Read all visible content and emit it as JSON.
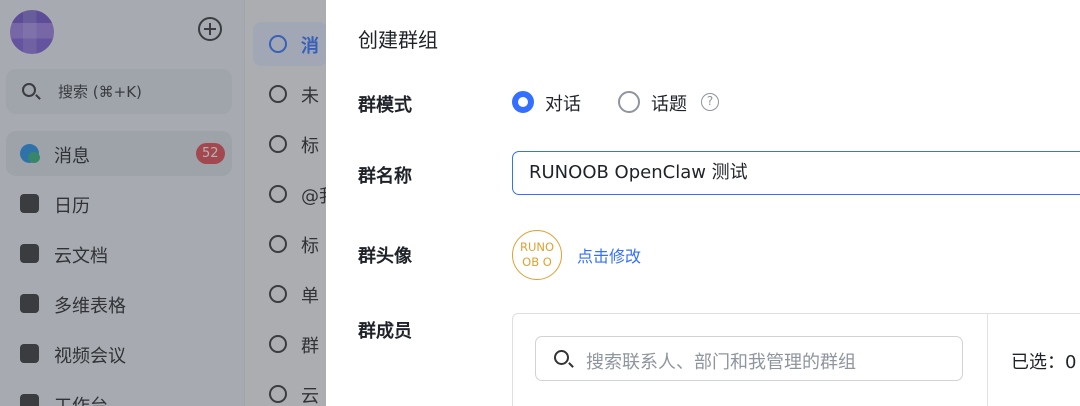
{
  "sidebar": {
    "search_placeholder": "搜索 (⌘+K)",
    "items": [
      {
        "label": "消息",
        "badge": "52",
        "icon": "message-icon"
      },
      {
        "label": "日历",
        "icon": "calendar-icon"
      },
      {
        "label": "云文档",
        "icon": "cloud-doc-icon"
      },
      {
        "label": "多维表格",
        "icon": "base-table-icon"
      },
      {
        "label": "视频会议",
        "icon": "video-meeting-icon"
      },
      {
        "label": "工作台",
        "icon": "workplace-icon"
      }
    ]
  },
  "middle_list": {
    "items": [
      {
        "label": "消",
        "icon": "message-icon"
      },
      {
        "label": "未",
        "icon": "unread-icon"
      },
      {
        "label": "标",
        "icon": "flag-icon"
      },
      {
        "label": "@我",
        "icon": "at-icon"
      },
      {
        "label": "标",
        "icon": "caret-down-icon"
      },
      {
        "label": "单",
        "icon": "person-icon"
      },
      {
        "label": "群",
        "icon": "group-icon"
      },
      {
        "label": "云",
        "icon": "cloud-doc-icon"
      }
    ]
  },
  "dialog": {
    "title": "创建群组",
    "mode": {
      "label": "群模式",
      "options": [
        {
          "label": "对话",
          "checked": true
        },
        {
          "label": "话题",
          "checked": false
        }
      ]
    },
    "name": {
      "label": "群名称",
      "value": "RUNOOB OpenClaw 测试"
    },
    "avatar": {
      "label": "群头像",
      "text_line1": "RUNO",
      "text_line2": "OB O",
      "edit_link": "点击修改"
    },
    "members": {
      "label": "群成员",
      "search_placeholder": "搜索联系人、部门和我管理的群组",
      "selected_text": "已选：0"
    }
  },
  "colors": {
    "accent": "#3370ff",
    "badge": "#e5484d",
    "avatar_border": "#e0a030"
  }
}
